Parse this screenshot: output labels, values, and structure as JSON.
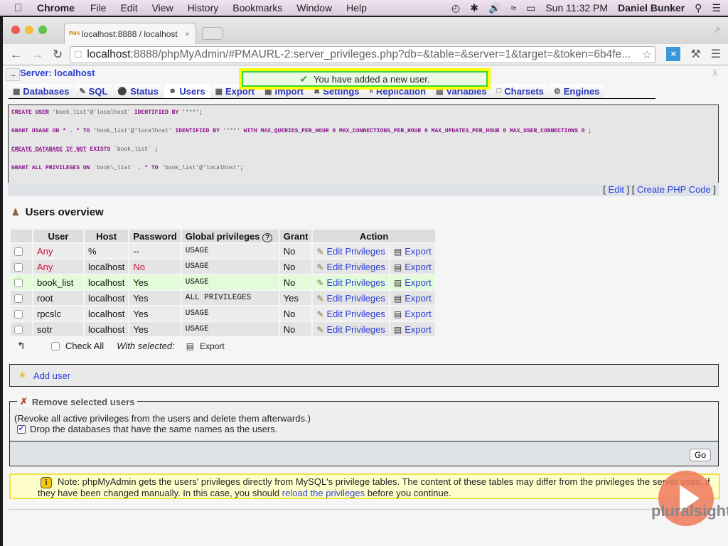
{
  "menubar": {
    "app": "Chrome",
    "items": [
      "File",
      "Edit",
      "View",
      "History",
      "Bookmarks",
      "Window",
      "Help"
    ],
    "clock": "Sun 11:32 PM",
    "user": "Daniel Bunker"
  },
  "browser": {
    "tab_title": "localhost:8888 / localhost",
    "favicon": "PMA",
    "url_host": "localhost",
    "url_rest": ":8888/phpMyAdmin/#PMAURL-2:server_privileges.php?db=&table=&server=1&target=&token=6b4fe..."
  },
  "pma": {
    "server_label": "Server: localhost",
    "notice": "You have added a new user.",
    "tabs": [
      "Databases",
      "SQL",
      "Status",
      "Users",
      "Export",
      "Import",
      "Settings",
      "Replication",
      "Variables",
      "Charsets",
      "Engines"
    ],
    "active_tab": "Users",
    "sql": {
      "line1": [
        "CREATE",
        "USER",
        "'book_list'@'localhost'",
        "IDENTIFIED BY",
        "'***'",
        ";"
      ],
      "line2_a": "GRANT USAGE ON * . * TO",
      "line2_b": "'book_list'@'localhost'",
      "line2_c": "IDENTIFIED BY",
      "line2_d": "'***'",
      "line2_e": "WITH MAX_QUERIES_PER_HOUR 0 MAX_CONNECTIONS_PER_HOUR 0 MAX_UPDATES_PER_HOUR 0 MAX_USER_CONNECTIONS 0 ;",
      "line3_a": "CREATE DATABASE",
      "line3_b": "IF NOT",
      "line3_c": "EXISTS",
      "line3_d": "`book_list`",
      "line3_e": ";",
      "line4_a": "GRANT ALL PRIVILEGES ON",
      "line4_b": "`book\\_list`",
      "line4_c": ". * TO",
      "line4_d": "'book_list'@'localhost'",
      "line4_e": ";",
      "edit": "Edit",
      "create_php": "Create PHP Code"
    },
    "overview_title": "Users overview",
    "columns": [
      "User",
      "Host",
      "Password",
      "Global privileges",
      "Grant",
      "Action"
    ],
    "rows": [
      {
        "user": "Any",
        "host": "%",
        "password": "--",
        "privileges": "USAGE",
        "grant": "No"
      },
      {
        "user": "Any",
        "host": "localhost",
        "password": "No",
        "privileges": "USAGE",
        "grant": "No"
      },
      {
        "user": "book_list",
        "host": "localhost",
        "password": "Yes",
        "privileges": "USAGE",
        "grant": "No"
      },
      {
        "user": "root",
        "host": "localhost",
        "password": "Yes",
        "privileges": "ALL PRIVILEGES",
        "grant": "Yes"
      },
      {
        "user": "rpcslc",
        "host": "localhost",
        "password": "Yes",
        "privileges": "USAGE",
        "grant": "No"
      },
      {
        "user": "sotr",
        "host": "localhost",
        "password": "Yes",
        "privileges": "USAGE",
        "grant": "No"
      }
    ],
    "edit_privileges": "Edit Privileges",
    "export": "Export",
    "check_all": "Check All",
    "with_selected": "With selected:",
    "add_user": "Add user",
    "remove_legend": "Remove selected users",
    "remove_desc": "(Revoke all active privileges from the users and delete them afterwards.)",
    "drop_db": "Drop the databases that have the same names as the users.",
    "go": "Go",
    "note_1": "Note: phpMyAdmin gets the users' privileges directly from MySQL's privilege tables. The content of these tables may differ from the privileges the server uses, if",
    "note_2": "they have been changed manually. In this case, you should",
    "note_link": "reload the privileges",
    "note_3": "before you continue."
  },
  "watermark": "pluralsight"
}
